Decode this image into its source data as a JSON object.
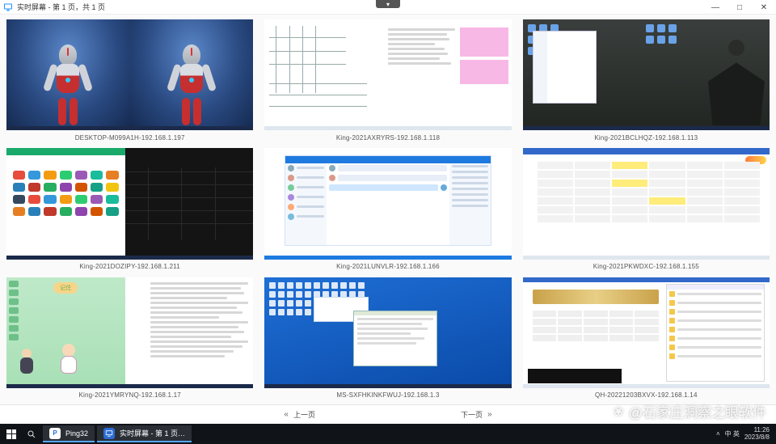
{
  "window": {
    "title": "实时屏幕 - 第 1 页，共 1 页",
    "min": "—",
    "max": "□",
    "close": "✕",
    "top_tab": "▾"
  },
  "thumbnails": [
    {
      "label": "DESKTOP-M099A1H-192.168.1.197"
    },
    {
      "label": "King-2021AXRYRS-192.168.1.118"
    },
    {
      "label": "King-2021BCLHQZ-192.168.1.113"
    },
    {
      "label": "King-2021DOZIPY-192.168.1.211"
    },
    {
      "label": "King-2021LUNVLR-192.168.1.166"
    },
    {
      "label": "King-2021PKWDXC-192.168.1.155"
    },
    {
      "label": "King-2021YMRYNQ-192.168.1.17"
    },
    {
      "label": "MS-SXFHKINKFWUJ-192.168.1.3"
    },
    {
      "label": "QH-20221203BXVX-192.168.1.14"
    }
  ],
  "pager": {
    "prev": "上一页",
    "next": "下一页",
    "prev_arrow": "«",
    "next_arrow": "»"
  },
  "taskbar": {
    "app1": "Ping32",
    "app2": "实时屏幕 - 第 1 页…",
    "tray_ime": "中 英",
    "clock_time": "11:26",
    "clock_date": "2023/8/8"
  },
  "watermark": {
    "flower": "❀",
    "text": "@石家庄洞察之眼软件"
  }
}
